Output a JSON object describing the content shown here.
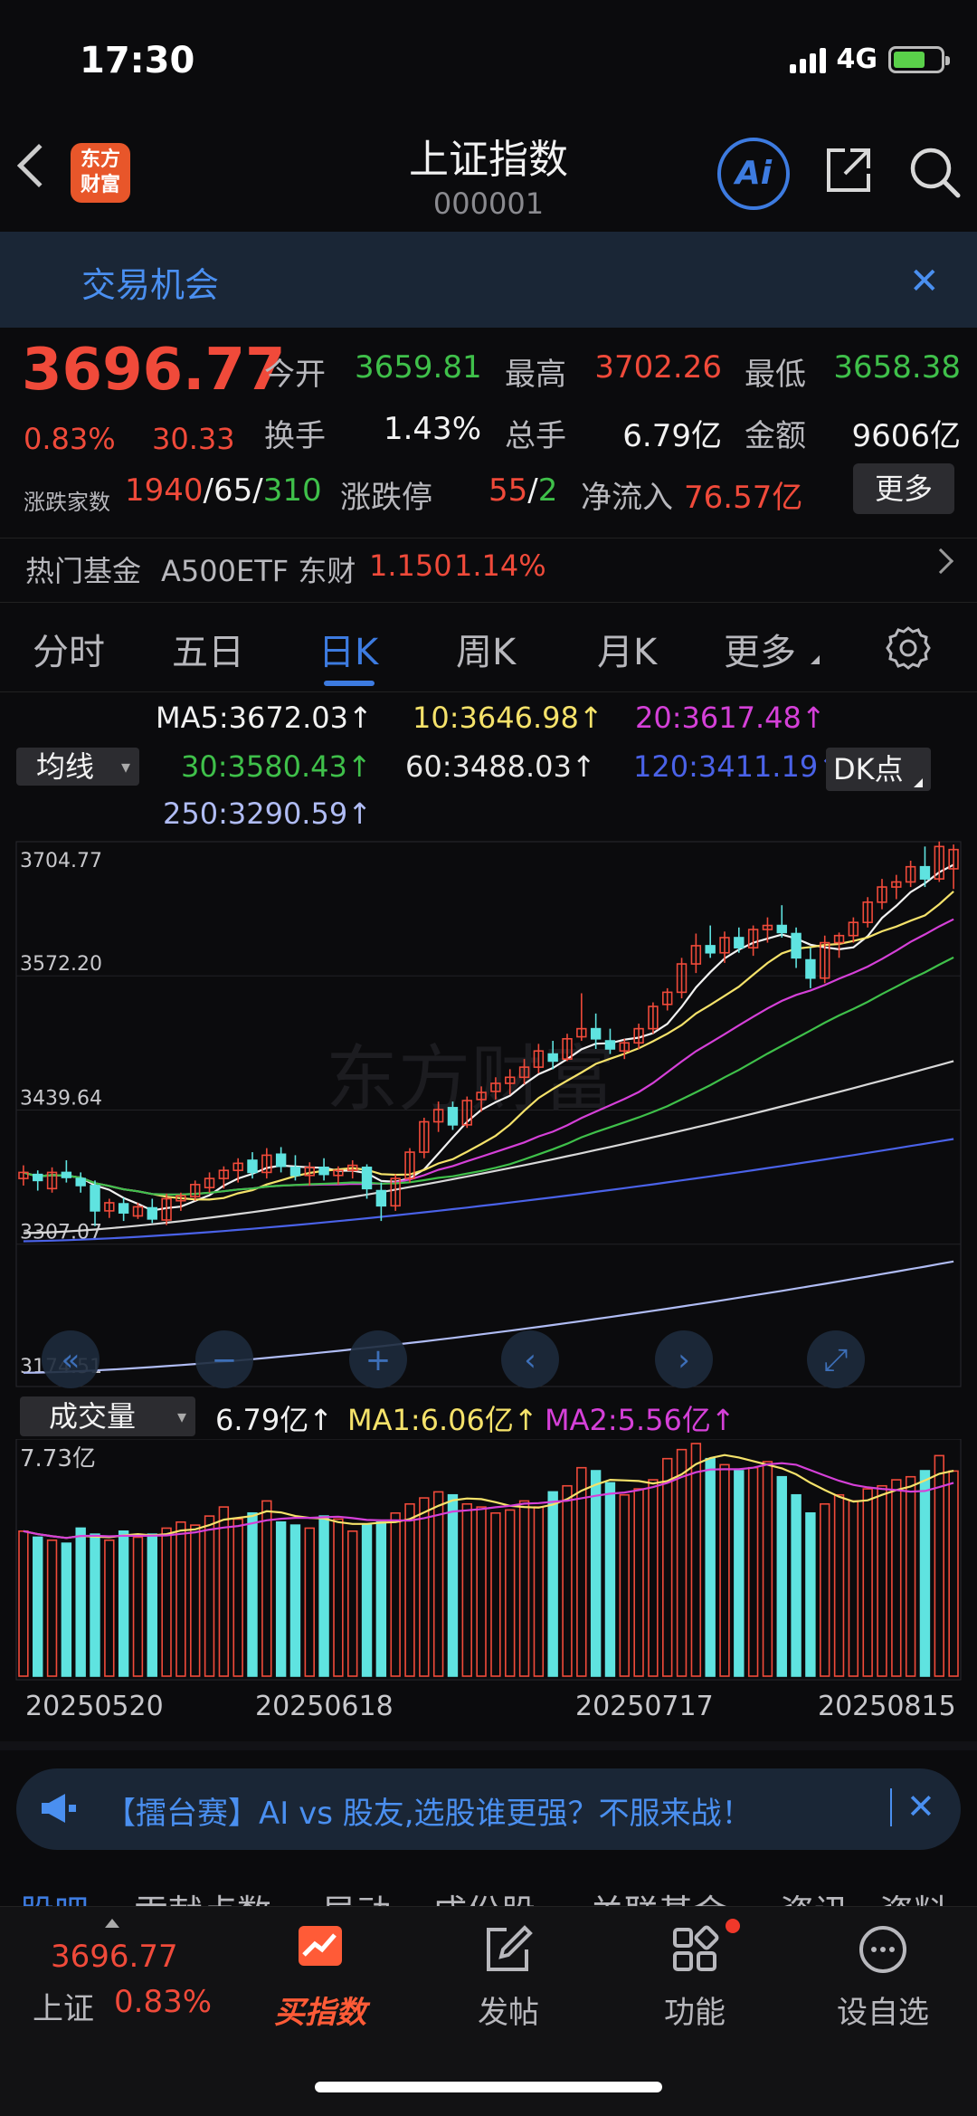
{
  "status": {
    "time": "17:30",
    "network": "4G"
  },
  "header": {
    "title": "上证指数",
    "code": "000001",
    "logo_text": "东方\n财富",
    "ai_label": "Ai"
  },
  "opportunity": {
    "text": "交易机会"
  },
  "quote": {
    "price": "3696.77",
    "change_pct": "0.83%",
    "change_abs": "30.33",
    "open_label": "今开",
    "open": "3659.81",
    "high_label": "最高",
    "high": "3702.26",
    "low_label": "最低",
    "low": "3658.38",
    "turnover_label": "换手",
    "turnover": "1.43%",
    "volume_label": "总手",
    "volume": "6.79亿",
    "amount_label": "金额",
    "amount": "9606亿",
    "counts_label": "涨跌家数",
    "up": "1940",
    "flat": "65",
    "down": "310",
    "limit_label": "涨跌停",
    "limit_up": "55",
    "limit_down": "2",
    "inflow_label": "净流入",
    "inflow": "76.57亿",
    "more": "更多"
  },
  "fund": {
    "label": "热门基金",
    "name": "A500ETF 东财",
    "price": "1.150",
    "change": "1.14%"
  },
  "period_tabs": [
    {
      "label": "分时"
    },
    {
      "label": "五日"
    },
    {
      "label": "日K"
    },
    {
      "label": "周K"
    },
    {
      "label": "月K"
    },
    {
      "label": "更多"
    }
  ],
  "ma_legend": {
    "select": "均线",
    "dk": "DK点",
    "ma5": "MA5:3672.03↑",
    "ma10": "10:3646.98↑",
    "ma20": "20:3617.48↑",
    "ma30": "30:3580.43↑",
    "ma60": "60:3488.03↑",
    "ma120": "120:3411.19↑",
    "ma250": "250:3290.59↑"
  },
  "price_axis": [
    "3704.77",
    "3572.20",
    "3439.64",
    "3307.07",
    "3174.51"
  ],
  "volume_legend": {
    "select": "成交量",
    "vol": "6.79亿↑",
    "ma1": "MA1:6.06亿↑",
    "ma2": "MA2:5.56亿↑",
    "max": "7.73亿"
  },
  "dates": [
    "20250520",
    "20250618",
    "20250717",
    "20250815"
  ],
  "ad": {
    "text": "【擂台赛】AI vs 股友,选股谁更强？不服来战！"
  },
  "info_tabs": [
    "股吧",
    "贡献点数",
    "异动",
    "成份股",
    "关联基金",
    "资讯",
    "资料"
  ],
  "bottom": {
    "price": "3696.77",
    "name": "上证",
    "pct": "0.83%",
    "buy": "买指数",
    "post": "发帖",
    "func": "功能",
    "watch": "设自选"
  },
  "colors": {
    "up": "#f04a3a",
    "down": "#5fe3e0",
    "accent": "#3d7be0"
  },
  "chart_data": {
    "type": "candlestick",
    "ylim": [
      3174.51,
      3704.77
    ],
    "ohlc": [
      [
        3372,
        3385,
        3365,
        3378
      ],
      [
        3376,
        3380,
        3360,
        3370
      ],
      [
        3362,
        3383,
        3358,
        3378
      ],
      [
        3378,
        3390,
        3368,
        3373
      ],
      [
        3372,
        3378,
        3358,
        3365
      ],
      [
        3365,
        3370,
        3325,
        3340
      ],
      [
        3340,
        3352,
        3333,
        3348
      ],
      [
        3347,
        3353,
        3330,
        3338
      ],
      [
        3335,
        3348,
        3332,
        3344
      ],
      [
        3343,
        3352,
        3328,
        3332
      ],
      [
        3331,
        3357,
        3326,
        3352
      ],
      [
        3350,
        3358,
        3340,
        3355
      ],
      [
        3354,
        3370,
        3350,
        3366
      ],
      [
        3363,
        3378,
        3358,
        3372
      ],
      [
        3372,
        3384,
        3362,
        3380
      ],
      [
        3380,
        3392,
        3368,
        3387
      ],
      [
        3390,
        3398,
        3372,
        3378
      ],
      [
        3378,
        3402,
        3372,
        3395
      ],
      [
        3396,
        3403,
        3378,
        3384
      ],
      [
        3383,
        3395,
        3370,
        3375
      ],
      [
        3375,
        3388,
        3365,
        3383
      ],
      [
        3383,
        3392,
        3370,
        3376
      ],
      [
        3375,
        3384,
        3366,
        3380
      ],
      [
        3380,
        3390,
        3372,
        3385
      ],
      [
        3383,
        3386,
        3352,
        3362
      ],
      [
        3360,
        3368,
        3330,
        3345
      ],
      [
        3345,
        3376,
        3340,
        3372
      ],
      [
        3372,
        3402,
        3368,
        3398
      ],
      [
        3398,
        3432,
        3392,
        3428
      ],
      [
        3428,
        3448,
        3418,
        3440
      ],
      [
        3442,
        3448,
        3420,
        3425
      ],
      [
        3425,
        3453,
        3422,
        3449
      ],
      [
        3450,
        3463,
        3438,
        3457
      ],
      [
        3458,
        3472,
        3450,
        3466
      ],
      [
        3466,
        3480,
        3455,
        3472
      ],
      [
        3472,
        3490,
        3465,
        3482
      ],
      [
        3482,
        3505,
        3476,
        3498
      ],
      [
        3495,
        3508,
        3480,
        3488
      ],
      [
        3490,
        3515,
        3488,
        3510
      ],
      [
        3512,
        3555,
        3508,
        3520
      ],
      [
        3520,
        3535,
        3500,
        3510
      ],
      [
        3508,
        3520,
        3495,
        3500
      ],
      [
        3498,
        3510,
        3490,
        3506
      ],
      [
        3506,
        3525,
        3500,
        3520
      ],
      [
        3520,
        3546,
        3515,
        3542
      ],
      [
        3544,
        3560,
        3538,
        3556
      ],
      [
        3556,
        3590,
        3550,
        3584
      ],
      [
        3584,
        3614,
        3575,
        3602
      ],
      [
        3602,
        3622,
        3590,
        3595
      ],
      [
        3595,
        3616,
        3585,
        3610
      ],
      [
        3610,
        3620,
        3595,
        3600
      ],
      [
        3600,
        3622,
        3592,
        3618
      ],
      [
        3618,
        3630,
        3605,
        3622
      ],
      [
        3622,
        3642,
        3610,
        3615
      ],
      [
        3614,
        3620,
        3580,
        3590
      ],
      [
        3588,
        3600,
        3560,
        3570
      ],
      [
        3570,
        3612,
        3565,
        3605
      ],
      [
        3605,
        3615,
        3590,
        3612
      ],
      [
        3612,
        3630,
        3605,
        3625
      ],
      [
        3625,
        3650,
        3620,
        3645
      ],
      [
        3645,
        3668,
        3638,
        3660
      ],
      [
        3660,
        3672,
        3648,
        3665
      ],
      [
        3665,
        3686,
        3660,
        3680
      ],
      [
        3680,
        3700,
        3660,
        3668
      ],
      [
        3668,
        3705,
        3665,
        3700
      ],
      [
        3678,
        3702,
        3658,
        3697
      ]
    ],
    "volume_yi": [
      4.8,
      4.6,
      4.5,
      4.4,
      4.9,
      4.7,
      4.5,
      4.8,
      4.6,
      4.7,
      4.9,
      5.1,
      5.0,
      5.3,
      5.6,
      5.2,
      5.4,
      5.8,
      5.1,
      5.0,
      4.9,
      5.3,
      5.2,
      4.8,
      5.0,
      5.1,
      5.4,
      5.7,
      5.9,
      6.1,
      6.0,
      5.7,
      5.6,
      5.4,
      5.5,
      5.8,
      5.6,
      6.1,
      6.3,
      6.9,
      6.8,
      6.4,
      6.0,
      6.2,
      6.5,
      7.2,
      7.5,
      7.7,
      7.2,
      7.0,
      6.8,
      6.9,
      7.1,
      6.6,
      6.0,
      5.4,
      5.7,
      6.0,
      5.8,
      6.2,
      6.3,
      6.5,
      6.6,
      6.8,
      7.3,
      6.79
    ]
  }
}
